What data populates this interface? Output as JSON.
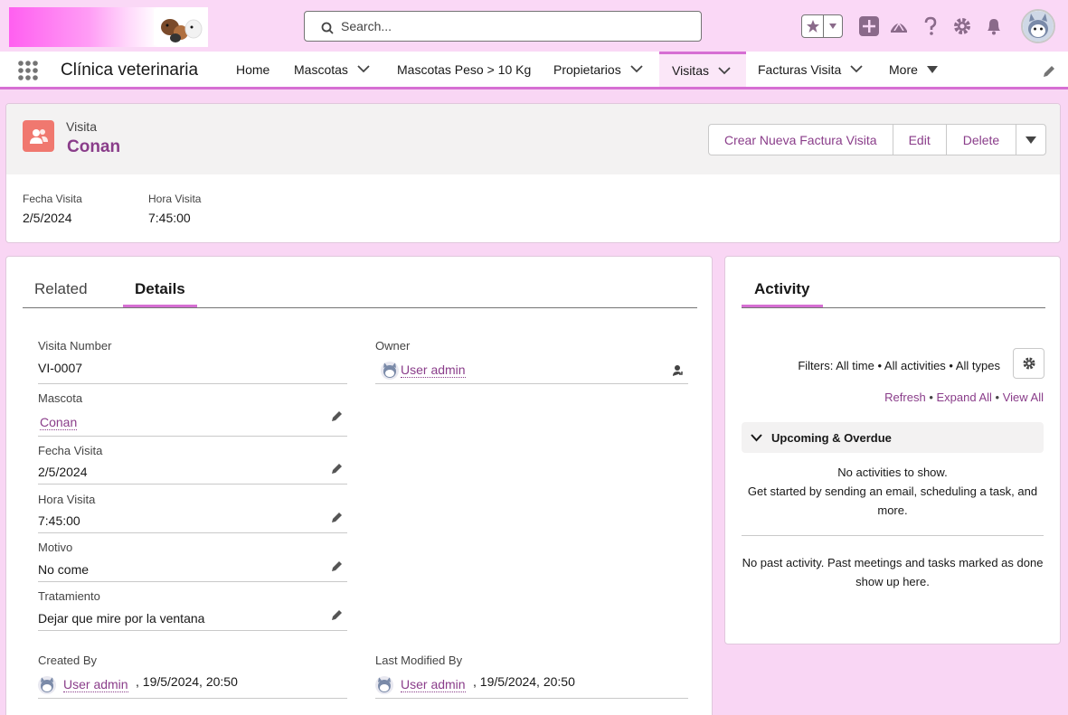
{
  "header": {
    "search_placeholder": "Search...",
    "icons": [
      "star-icon",
      "chevron-down-icon",
      "add-icon",
      "trailhead-icon",
      "help-icon",
      "gear-icon",
      "bell-icon",
      "avatar"
    ]
  },
  "nav": {
    "app_name": "Clínica veterinaria",
    "items": [
      {
        "label": "Home"
      },
      {
        "label": "Mascotas"
      },
      {
        "label": "Mascotas Peso > 10 Kg"
      },
      {
        "label": "Propietarios"
      },
      {
        "label": "Visitas"
      },
      {
        "label": "Facturas Visita"
      },
      {
        "label": "More"
      }
    ],
    "active": "Visitas"
  },
  "record": {
    "object_label": "Visita",
    "title": "Conan",
    "actions": [
      "Crear Nueva Factura Visita",
      "Edit",
      "Delete"
    ],
    "highlights": [
      {
        "label": "Fecha Visita",
        "value": "2/5/2024"
      },
      {
        "label": "Hora Visita",
        "value": "7:45:00"
      }
    ]
  },
  "tabs": {
    "related": "Related",
    "details": "Details",
    "active": "Details"
  },
  "details": {
    "visita_number": {
      "label": "Visita Number",
      "value": "VI-0007"
    },
    "owner": {
      "label": "Owner",
      "value": "User admin"
    },
    "mascota": {
      "label": "Mascota",
      "value": "Conan"
    },
    "fecha_visita": {
      "label": "Fecha Visita",
      "value": "2/5/2024"
    },
    "hora_visita": {
      "label": "Hora Visita",
      "value": "7:45:00"
    },
    "motivo": {
      "label": "Motivo",
      "value": "No come"
    },
    "tratamiento": {
      "label": "Tratamiento",
      "value": "Dejar que mire por la ventana"
    },
    "created_by": {
      "label": "Created By",
      "user": "User admin",
      "date": ", 19/5/2024, 20:50"
    },
    "last_modified_by": {
      "label": "Last Modified By",
      "user": "User admin",
      "date": ", 19/5/2024, 20:50"
    }
  },
  "activity": {
    "tab": "Activity",
    "filters": "Filters: All time • All activities • All types",
    "links": {
      "refresh": "Refresh",
      "expand_all": "Expand All",
      "view_all": "View All",
      "sep": " • "
    },
    "upcoming_label": "Upcoming & Overdue",
    "no_activities": "No activities to show.",
    "get_started": "Get started by sending an email, scheduling a task, and more.",
    "no_past": "No past activity. Past meetings and tasks marked as done show up here."
  },
  "colors": {
    "brand": "#8a3d8a",
    "accent": "#d66fd3",
    "record_icon": "#f0786f",
    "header_bg": "#fad8f6"
  }
}
